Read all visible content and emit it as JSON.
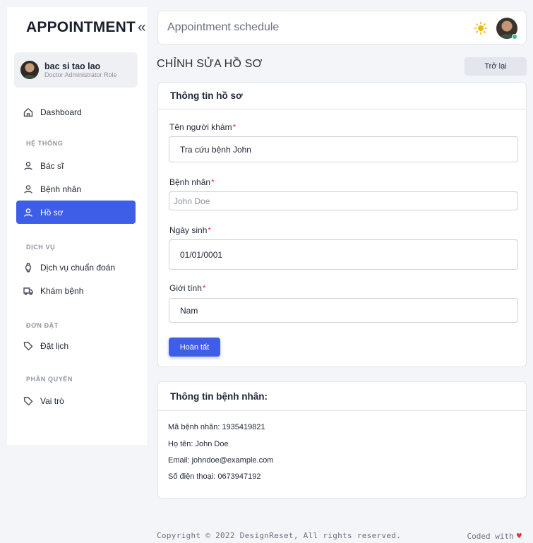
{
  "sidebar": {
    "brand": "APPOINTMENT",
    "collapse_icon": "«",
    "user": {
      "name": "bac si tao lao",
      "role": "Doctor Administrator Role"
    },
    "dashboard": "Dashboard",
    "sections": [
      {
        "title": "HỆ THỐNG",
        "items": [
          "Bác sĩ",
          "Bệnh nhân",
          "Hồ sơ"
        ]
      },
      {
        "title": "DỊCH VỤ",
        "items": [
          "Dịch vụ chuẩn đoán",
          "Khám bệnh"
        ]
      },
      {
        "title": "ĐƠN ĐẶT",
        "items": [
          "Đặt lịch"
        ]
      },
      {
        "title": "PHÂN QUYỀN",
        "items": [
          "Vai trò"
        ]
      }
    ],
    "active_item": "Hồ sơ"
  },
  "header": {
    "title": "Appointment schedule",
    "theme_icon": "sun-icon",
    "sun_color": "#f5b400"
  },
  "page": {
    "title": "CHỈNH SỬA HỒ SƠ",
    "back_label": "Trở lại"
  },
  "profile_form": {
    "card_title": "Thông tin hồ sơ",
    "fields": {
      "examiner": {
        "label": "Tên người khám",
        "value": "Tra cứu bệnh John"
      },
      "patient": {
        "label": "Bệnh nhân",
        "placeholder": "John Doe"
      },
      "dob": {
        "label": "Ngày sinh",
        "value": "01/01/0001"
      },
      "gender": {
        "label": "Giới tính",
        "value": "Nam"
      }
    },
    "required_mark": "*",
    "submit_label": "Hoàn tất"
  },
  "patient_info": {
    "card_title": "Thông tin bệnh nhân:",
    "lines": [
      "Mã bệnh nhân: 1935419821",
      "Họ tên: John Doe",
      "Email: johndoe@example.com",
      "Số điện thoại: 0673947192"
    ]
  },
  "footer": {
    "copyright": "Copyright © 2022 DesignReset, All rights reserved.",
    "coded_with": "Coded with",
    "heart": "♥"
  },
  "colors": {
    "accent": "#3e5ee8",
    "required": "#e0373f"
  }
}
